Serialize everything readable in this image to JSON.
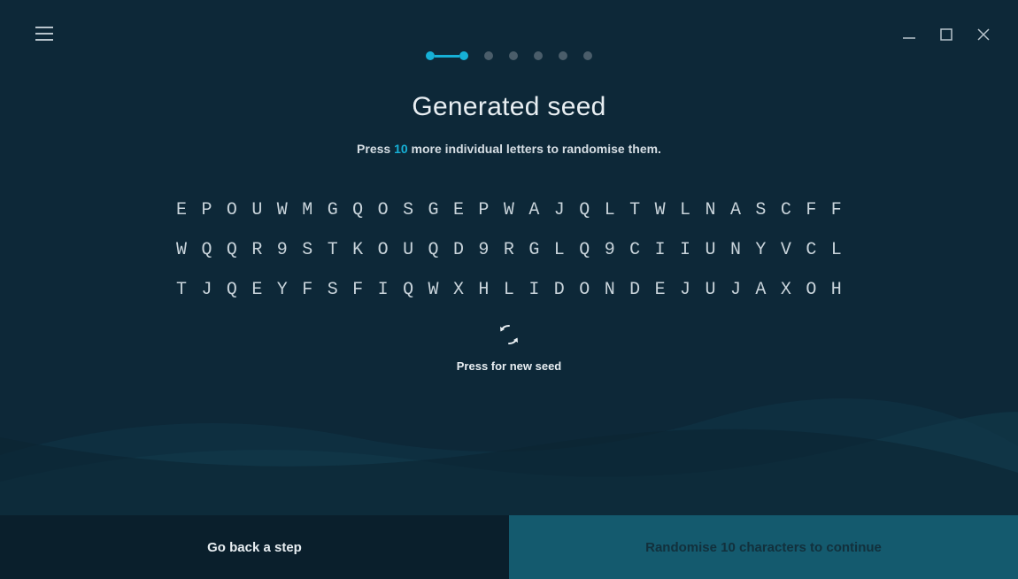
{
  "header": {
    "title": "Generated seed",
    "subtitle_prefix": "Press",
    "subtitle_count": 10,
    "subtitle_suffix": "more individual letters to randomise them."
  },
  "progress": {
    "current_step": 2,
    "groups": [
      2,
      1,
      1,
      1,
      1,
      1
    ],
    "active_dots": 2
  },
  "seed": {
    "rows": [
      [
        "E",
        "P",
        "O",
        "U",
        "W",
        "M",
        "G",
        "Q",
        "O",
        "S",
        "G",
        "E",
        "P",
        "W",
        "A",
        "J",
        "Q",
        "L",
        "T",
        "W",
        "L",
        "N",
        "A",
        "S",
        "C",
        "F",
        "F"
      ],
      [
        "W",
        "Q",
        "Q",
        "R",
        "9",
        "S",
        "T",
        "K",
        "O",
        "U",
        "Q",
        "D",
        "9",
        "R",
        "G",
        "L",
        "Q",
        "9",
        "C",
        "I",
        "I",
        "U",
        "N",
        "Y",
        "V",
        "C",
        "L"
      ],
      [
        "T",
        "J",
        "Q",
        "E",
        "Y",
        "F",
        "S",
        "F",
        "I",
        "Q",
        "W",
        "X",
        "H",
        "L",
        "I",
        "D",
        "O",
        "N",
        "D",
        "E",
        "J",
        "U",
        "J",
        "A",
        "X",
        "O",
        "H"
      ]
    ]
  },
  "new_seed": {
    "label": "Press for new seed"
  },
  "footer": {
    "back_label": "Go back a step",
    "next_label": "Randomise 10 characters to continue"
  },
  "colors": {
    "accent": "#16b0d6",
    "bg": "#0d2838",
    "footer_back": "#0a1f2c",
    "footer_next": "#145a6e"
  }
}
